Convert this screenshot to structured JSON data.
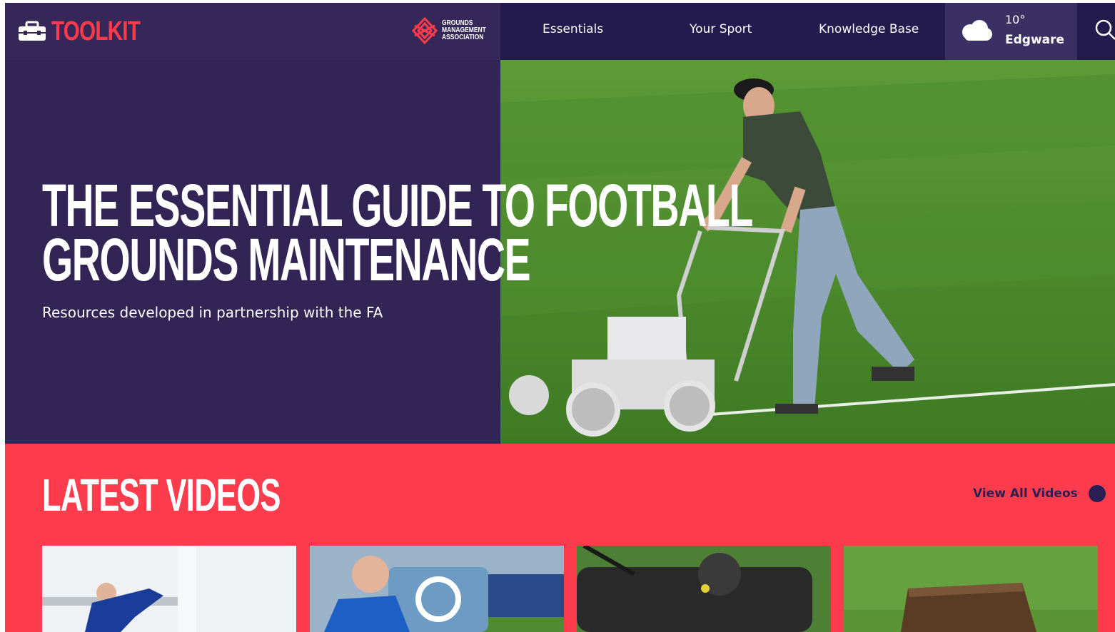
{
  "header": {
    "logo_text": "TOOLKIT",
    "partner": {
      "line1": "GROUNDS",
      "line2": "MANAGEMENT",
      "line3": "ASSOCIATION"
    },
    "nav": [
      {
        "label": "Essentials"
      },
      {
        "label": "Your Sport"
      },
      {
        "label": "Knowledge Base"
      }
    ],
    "weather": {
      "temperature": "10°",
      "location": "Edgware",
      "icon": "cloud-icon"
    },
    "search_icon": "search-icon"
  },
  "hero": {
    "title_line1": "THE ESSENTIAL GUIDE TO FOOTBALL",
    "title_line2": "GROUNDS MAINTENANCE",
    "subtitle": "Resources developed in partnership with the FA"
  },
  "videos": {
    "heading": "LATEST VIDEOS",
    "view_all_label": "View All Videos"
  },
  "colors": {
    "brand_red": "#fc3c4c",
    "header_nav": "#231a4d",
    "hero_panel": "#322555",
    "weather_panel": "#3a3064"
  }
}
